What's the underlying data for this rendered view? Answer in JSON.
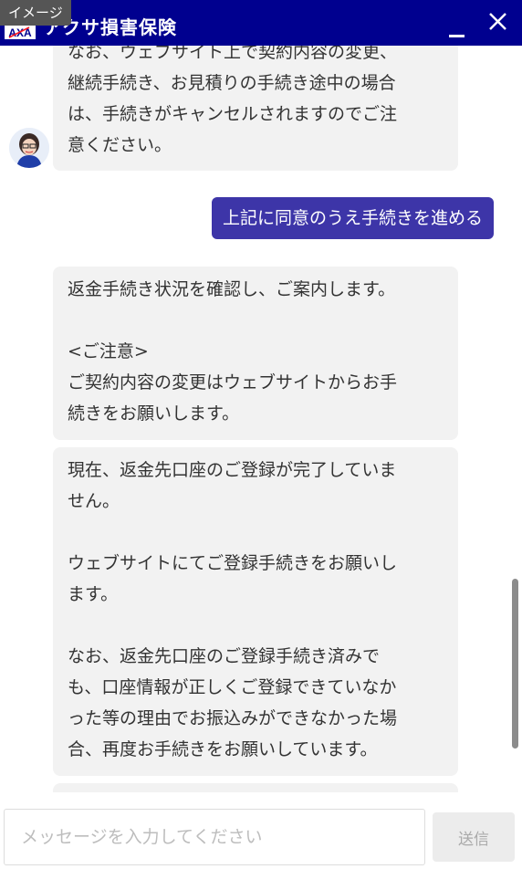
{
  "overlay": {
    "label": "イメージ"
  },
  "header": {
    "title": "アクサ損害保険",
    "logo_text": "AXA"
  },
  "messages": [
    {
      "from": "bot",
      "text": "なお、ウェブサイト上で契約内容の変更、\n継続手続き、お見積りの手続き途中の場合\nは、手続きがキャンセルされますのでご注\n意ください。"
    },
    {
      "from": "user",
      "text": "上記に同意のうえ手続きを進める"
    },
    {
      "from": "bot",
      "text": "返金手続き状況を確認し、ご案内します。\n\n<ご注意>\nご契約内容の変更はウェブサイトからお手\n続きをお願いします。"
    },
    {
      "from": "bot",
      "text": "現在、返金先口座のご登録が完了していま\nせん。\n\nウェブサイトにてご登録手続きをお願いし\nます。\n\nなお、返金先口座のご登録手続き済みで\nも、口座情報が正しくご登録できていなか\nった等の理由でお振込みができなかった場\n合、再度お手続きをお願いしています。"
    }
  ],
  "composer": {
    "placeholder": "メッセージを入力してください",
    "send_label": "送信"
  },
  "colors": {
    "header_bg": "#00008f",
    "user_bubble": "#3d35a8",
    "bot_bubble": "#f2f2f2"
  }
}
